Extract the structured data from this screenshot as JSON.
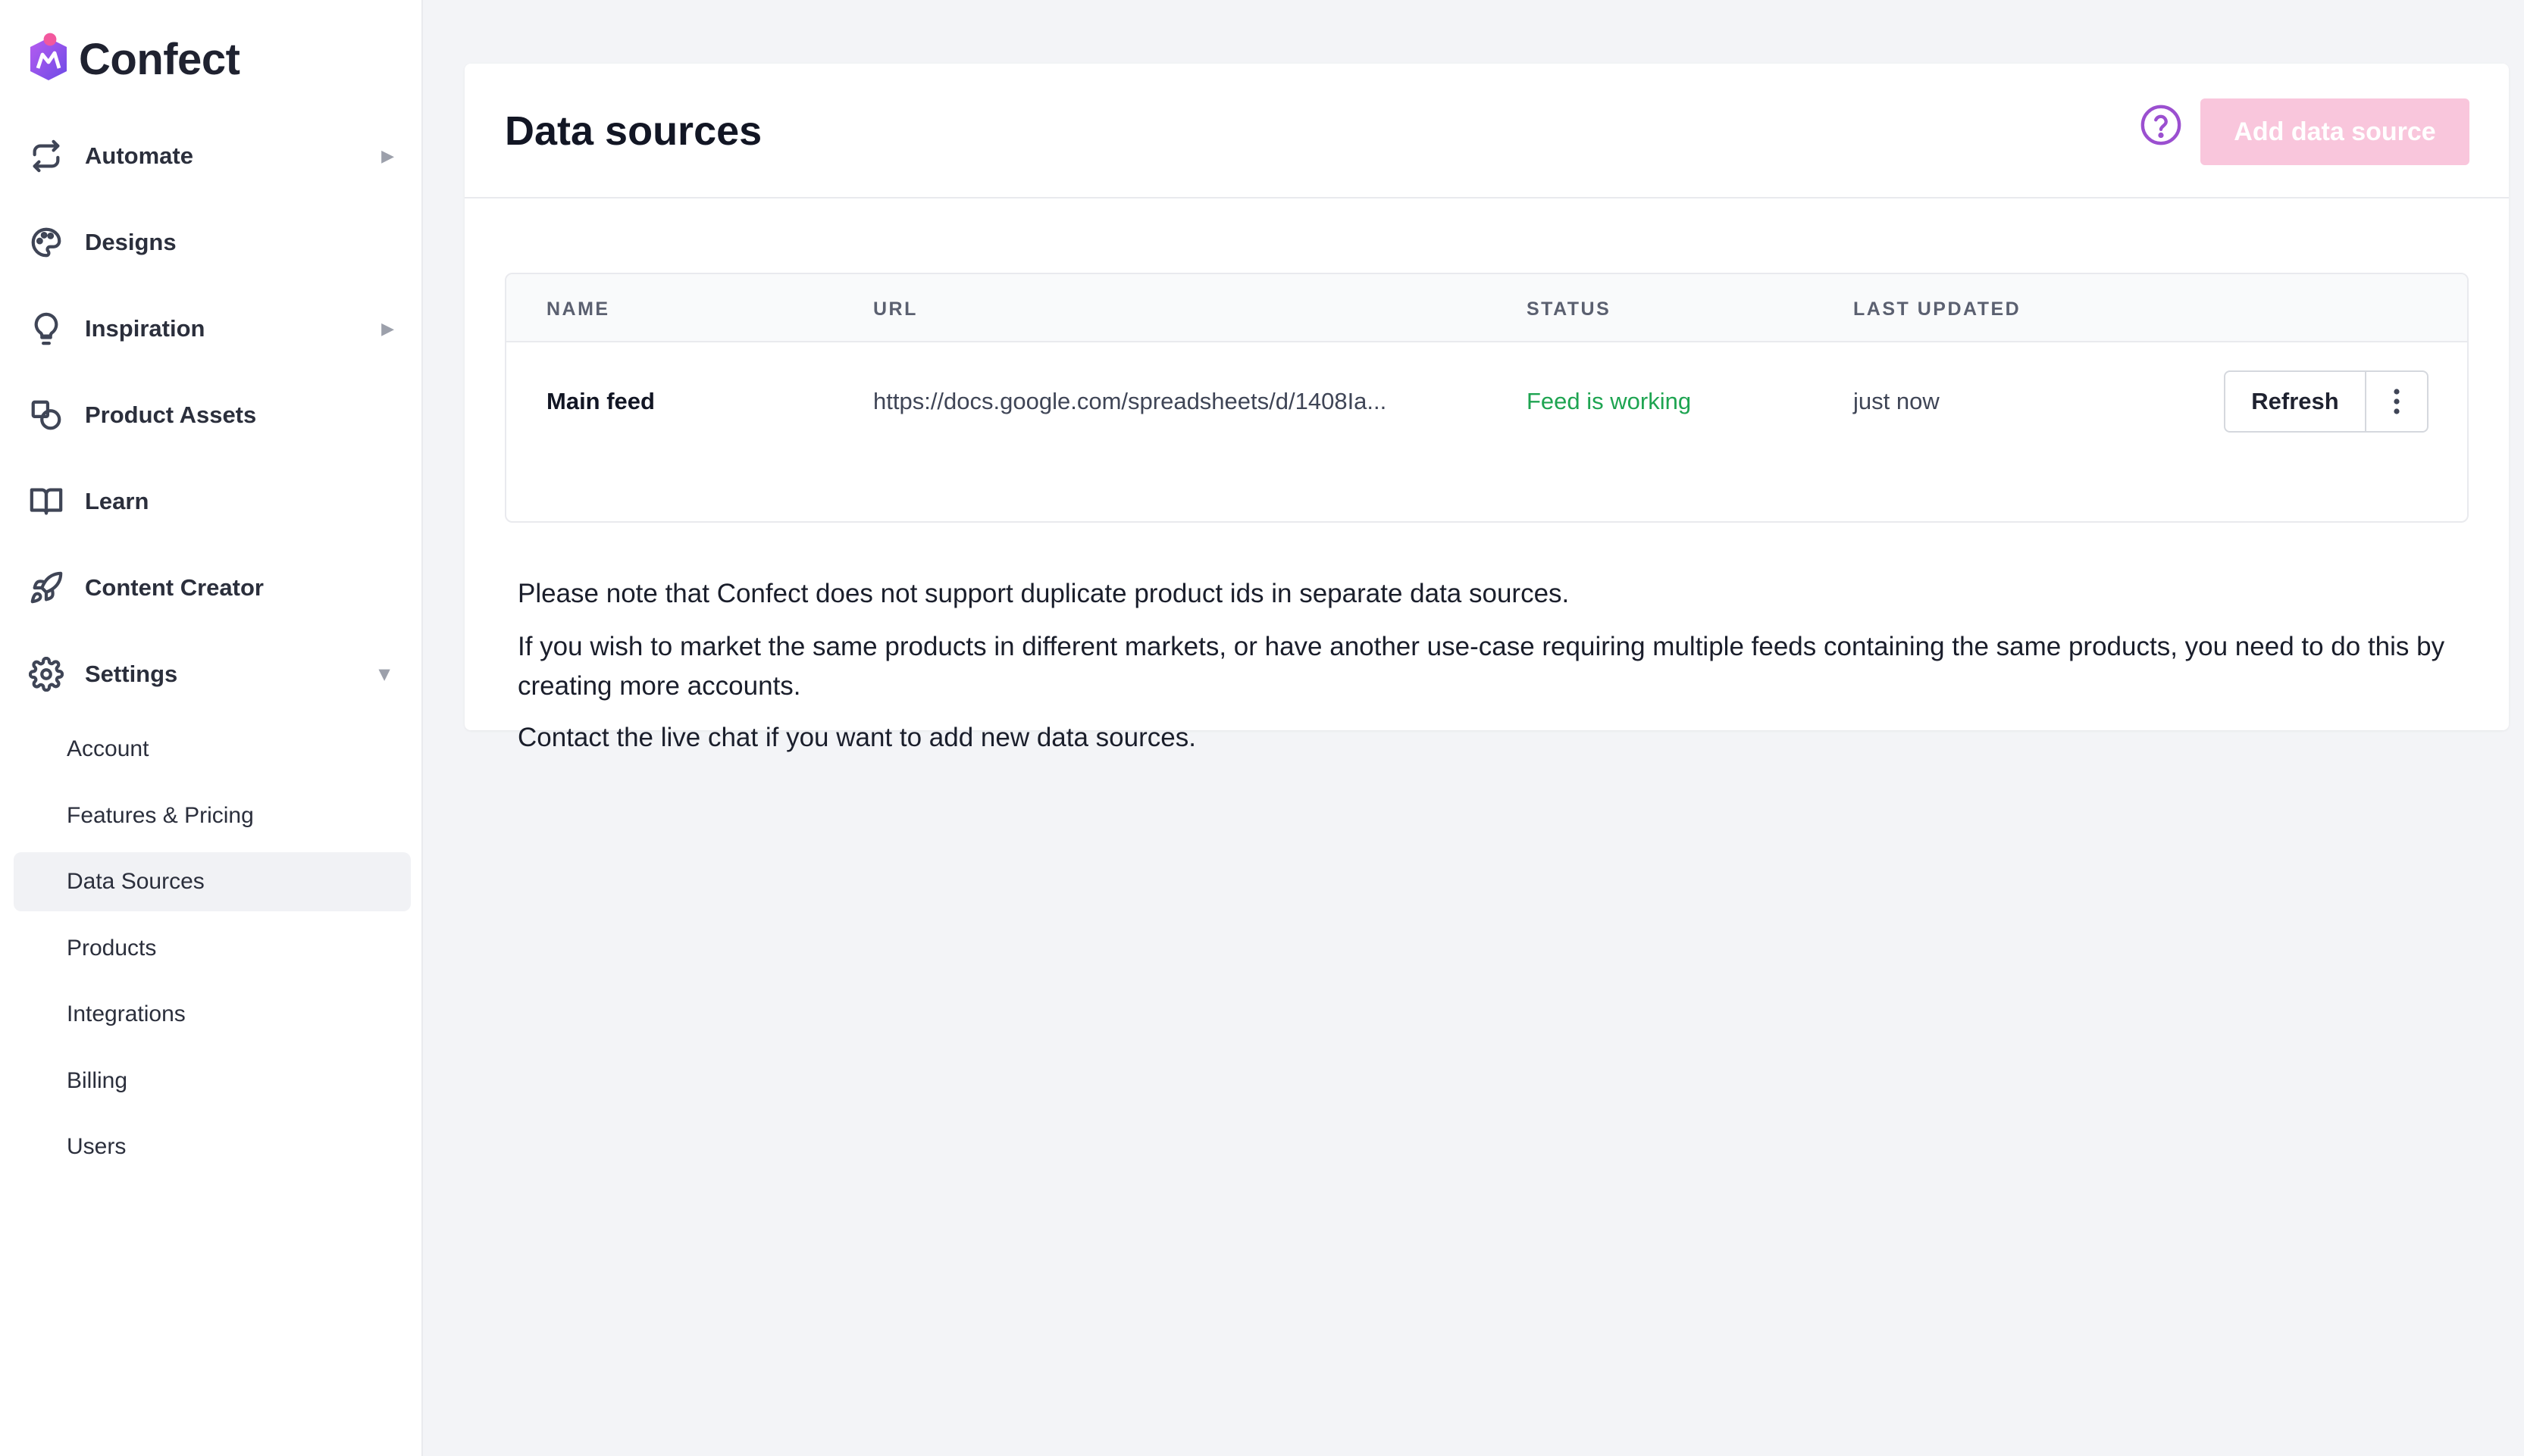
{
  "app": {
    "name": "Confect",
    "brand_color": "#e75aa5"
  },
  "sidebar": {
    "items": [
      {
        "label": "Automate",
        "icon": "repeat-icon",
        "has_arrow": true
      },
      {
        "label": "Designs",
        "icon": "palette-icon",
        "has_arrow": false
      },
      {
        "label": "Inspiration",
        "icon": "lightbulb-icon",
        "has_arrow": true
      },
      {
        "label": "Product Assets",
        "icon": "shapes-icon",
        "has_arrow": false
      },
      {
        "label": "Learn",
        "icon": "book-icon",
        "has_arrow": false
      },
      {
        "label": "Content Creator",
        "icon": "rocket-icon",
        "has_arrow": false
      },
      {
        "label": "Settings",
        "icon": "gear-icon",
        "has_arrow": true,
        "expanded": true
      }
    ],
    "settings_subitems": [
      {
        "label": "Account"
      },
      {
        "label": "Features & Pricing"
      },
      {
        "label": "Data Sources",
        "active": true
      },
      {
        "label": "Products"
      },
      {
        "label": "Integrations"
      },
      {
        "label": "Billing"
      },
      {
        "label": "Users"
      }
    ]
  },
  "main": {
    "title": "Data sources",
    "add_button_label": "Add data source",
    "help_icon": "question-circle-icon",
    "table": {
      "columns": [
        "NAME",
        "URL",
        "STATUS",
        "LAST UPDATED"
      ],
      "rows": [
        {
          "name": "Main feed",
          "url": "https://docs.google.com/spreadsheets/d/1408Ia...",
          "status": "Feed is working",
          "last_updated": "just now",
          "refresh_label": "Refresh"
        }
      ]
    },
    "notes": [
      "Please note that Confect does not support duplicate product ids in separate data sources.",
      "If you wish to market the same products in different markets, or have another use-case requiring multiple feeds containing the same products, you need to do this by creating more accounts.",
      "Contact the live chat if you want to add new data sources."
    ]
  }
}
